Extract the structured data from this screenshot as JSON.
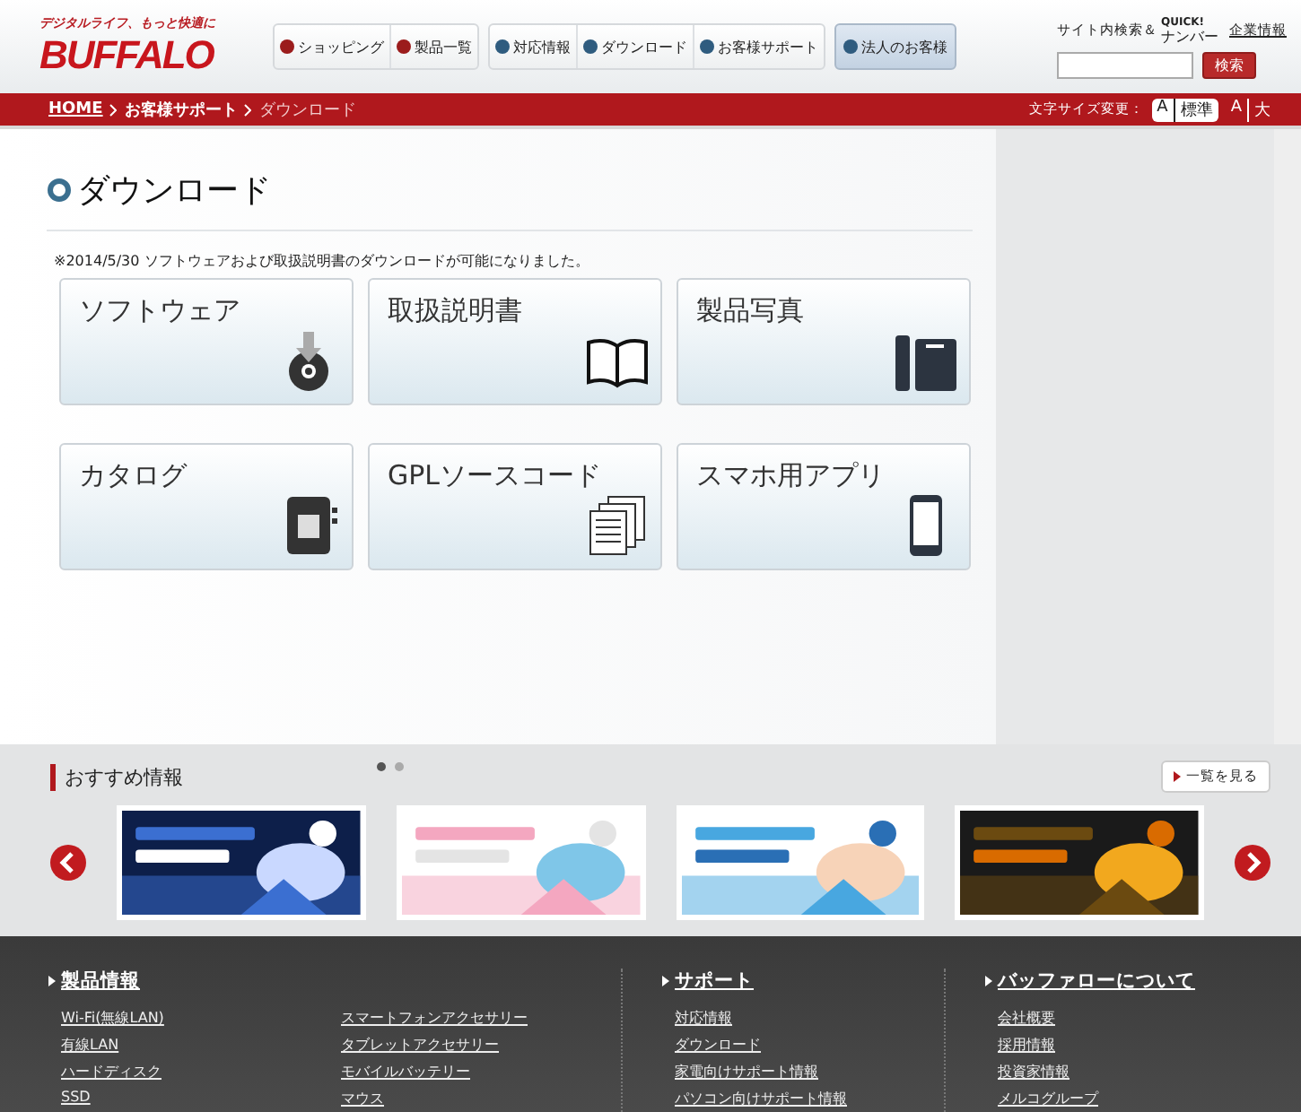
{
  "header": {
    "tagline": "デジタルライフ、もっと快適に",
    "logo": "BUFFALO",
    "nav_groups": [
      [
        "ショッピング",
        "製品一覧"
      ],
      [
        "対応情報",
        "ダウンロード",
        "お客様サポート"
      ]
    ],
    "corporate_button": "法人のお客様",
    "site_search_label": "サイト内検索＆",
    "quick_logo": "QUICK!",
    "quick_sub": "ナンバー",
    "corporate_info_link": "企業情報",
    "search_button": "検索"
  },
  "breadcrumb": {
    "items": [
      "HOME",
      "お客様サポート",
      "ダウンロード"
    ]
  },
  "font_size": {
    "label": "文字サイズ変更：",
    "options": [
      {
        "letter": "A",
        "label": "標準",
        "selected": true
      },
      {
        "letter": "A",
        "label": "大",
        "selected": false
      }
    ]
  },
  "main": {
    "title": "ダウンロード",
    "notice": "※2014/5/30 ソフトウェアおよび取扱説明書のダウンロードが可能になりました。",
    "tiles": [
      "ソフトウェア",
      "取扱説明書",
      "製品写真",
      "カタログ",
      "GPLソースコード",
      "スマホ用アプリ"
    ]
  },
  "recommend": {
    "title": "おすすめ情報",
    "dots": [
      {
        "selected": true
      },
      {
        "selected": false
      }
    ],
    "view_all": "一覧を見る"
  },
  "footer": {
    "sections": [
      {
        "title": "製品情報",
        "columns": [
          [
            "Wi-Fi(無線LAN)",
            "有線LAN",
            "ハードディスク",
            "SSD"
          ],
          [
            "スマートフォンアクセサリー",
            "タブレットアクセサリー",
            "モバイルバッテリー",
            "マウス"
          ]
        ]
      },
      {
        "title": "サポート",
        "columns": [
          [
            "対応情報",
            "ダウンロード",
            "家電向けサポート情報",
            "パソコン向けサポート情報"
          ]
        ]
      },
      {
        "title": "バッファローについて",
        "columns": [
          [
            "会社概要",
            "採用情報",
            "投資家情報",
            "メルコグループ"
          ]
        ]
      }
    ]
  }
}
